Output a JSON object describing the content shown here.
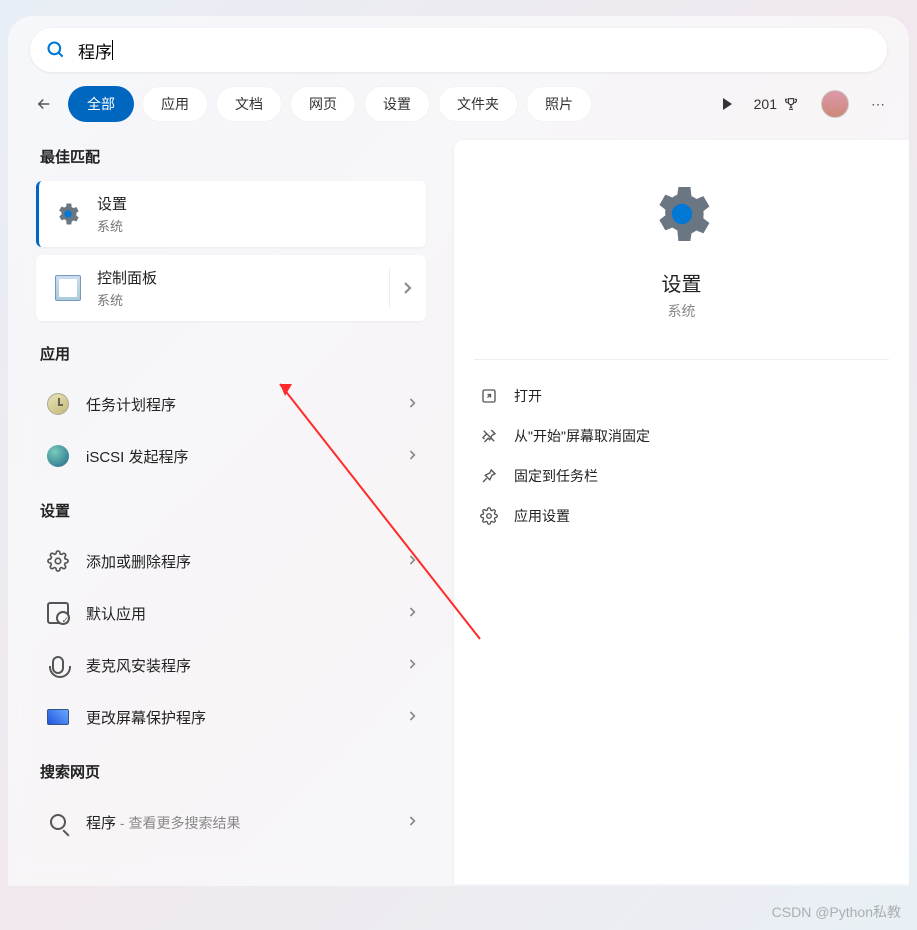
{
  "search": {
    "query": "程序"
  },
  "tabs": {
    "all": "全部",
    "apps": "应用",
    "docs": "文档",
    "web": "网页",
    "settings": "设置",
    "folders": "文件夹",
    "photos": "照片"
  },
  "points": "201",
  "sections": {
    "best": "最佳匹配",
    "apps": "应用",
    "settings": "设置",
    "web": "搜索网页"
  },
  "best": {
    "settings": {
      "title": "设置",
      "sub": "系统"
    },
    "control": {
      "title": "控制面板",
      "sub": "系统"
    }
  },
  "appRows": {
    "task": "任务计划程序",
    "iscsi": "iSCSI 发起程序"
  },
  "settingRows": {
    "addremove": "添加或删除程序",
    "default": "默认应用",
    "mic": "麦克风安装程序",
    "screensaver": "更改屏幕保护程序"
  },
  "webRow": {
    "prefix": "程序",
    "suffix": " - 查看更多搜索结果"
  },
  "detail": {
    "title": "设置",
    "sub": "系统"
  },
  "actions": {
    "open": "打开",
    "unpin": "从\"开始\"屏幕取消固定",
    "pin": "固定到任务栏",
    "appset": "应用设置"
  },
  "watermark": "CSDN @Python私教"
}
